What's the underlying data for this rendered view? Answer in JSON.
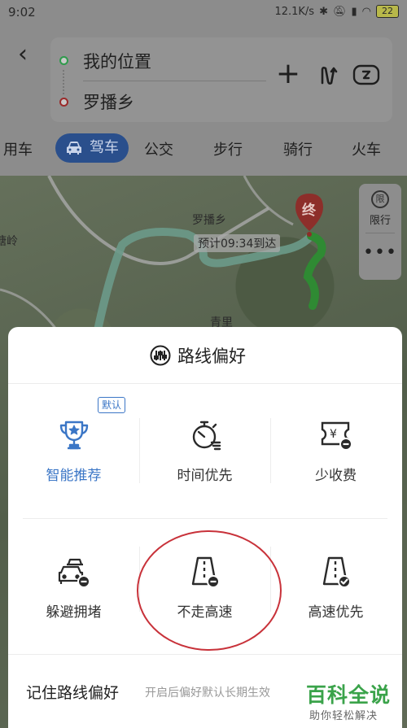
{
  "status_bar": {
    "time": "9:02",
    "network_speed": "12.1K/s",
    "battery": "22"
  },
  "route_input": {
    "origin": "我的位置",
    "destination": "罗播乡"
  },
  "transport_modes": [
    {
      "label": "用车"
    },
    {
      "label": "驾车",
      "active": true
    },
    {
      "label": "公交"
    },
    {
      "label": "步行"
    },
    {
      "label": "骑行"
    },
    {
      "label": "火车"
    }
  ],
  "map": {
    "place_label": "罗播乡",
    "left_label": "塘岭",
    "bottom_label": "青里",
    "eta_text": "预计09:34到达",
    "end_marker": "终",
    "limit_icon_text": "限",
    "limit_label": "限行",
    "more_label": "•••",
    "route_colors": {
      "main": "#6c9a8a",
      "traffic": "#2f8a33"
    }
  },
  "route_preference": {
    "title": "路线偏好",
    "default_badge": "默认",
    "options": [
      {
        "label": "智能推荐",
        "icon": "trophy-icon",
        "selected": true
      },
      {
        "label": "时间优先",
        "icon": "stopwatch-icon"
      },
      {
        "label": "少收费",
        "icon": "toll-ticket-icon"
      },
      {
        "label": "躲避拥堵",
        "icon": "car-jam-icon"
      },
      {
        "label": "不走高速",
        "icon": "no-highway-icon"
      },
      {
        "label": "高速优先",
        "icon": "highway-check-icon"
      }
    ],
    "remember_label": "记住路线偏好",
    "remember_hint": "开启后偏好默认长期生效"
  },
  "watermark": {
    "main": "百科全说",
    "sub": "助你轻松解决"
  },
  "colors": {
    "accent": "#3b76c6",
    "annotation": "#c8323a",
    "watermark": "#3aa34a"
  }
}
